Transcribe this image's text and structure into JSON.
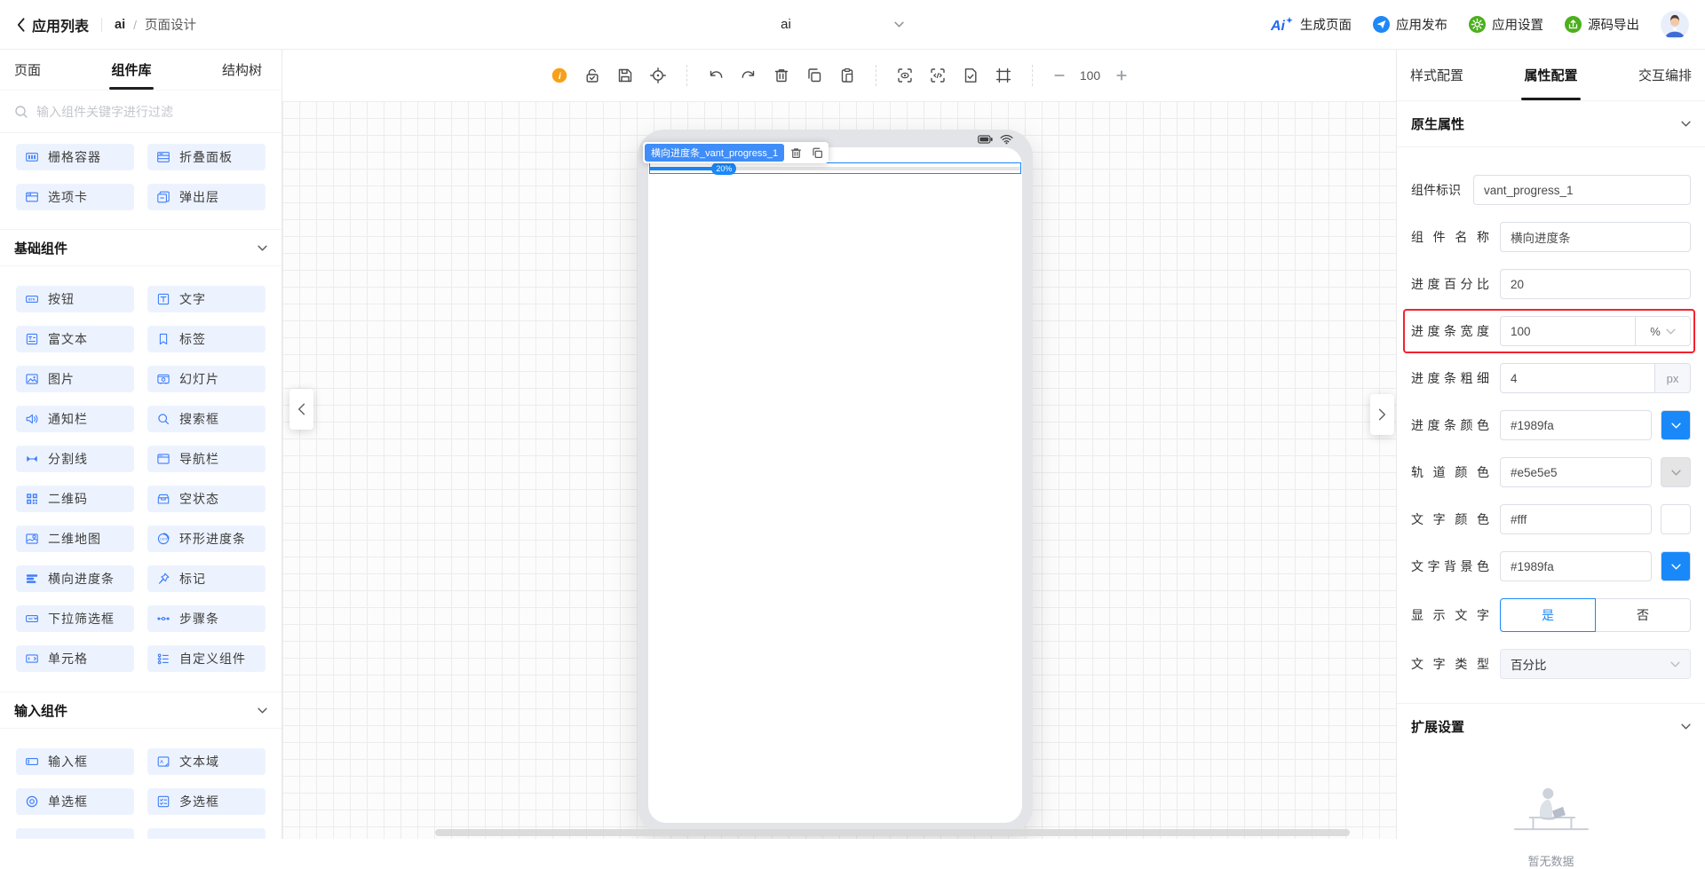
{
  "header": {
    "back_label": "应用列表",
    "breadcrumb": {
      "app": "ai",
      "separator": "/",
      "page": "页面设计"
    },
    "center_title": "ai",
    "actions": [
      {
        "label": "生成页面",
        "icon": "ai-generate-icon"
      },
      {
        "label": "应用发布",
        "icon": "publish-icon"
      },
      {
        "label": "应用设置",
        "icon": "app-settings-icon"
      },
      {
        "label": "源码导出",
        "icon": "code-export-icon"
      }
    ]
  },
  "sidebar": {
    "tabs": [
      {
        "label": "页面",
        "active": false
      },
      {
        "label": "组件库",
        "active": true
      },
      {
        "label": "结构树",
        "active": false
      }
    ],
    "search_placeholder": "输入组件关键字进行过滤",
    "top_items": [
      {
        "label": "栅格容器",
        "icon": "grid-container-icon"
      },
      {
        "label": "折叠面板",
        "icon": "collapse-panel-icon"
      },
      {
        "label": "选项卡",
        "icon": "tabs-component-icon"
      },
      {
        "label": "弹出层",
        "icon": "popup-layer-icon"
      }
    ],
    "sections": [
      {
        "title": "基础组件",
        "partial_row": false,
        "items": [
          {
            "label": "按钮",
            "icon": "button-component-icon"
          },
          {
            "label": "文字",
            "icon": "text-component-icon"
          },
          {
            "label": "富文本",
            "icon": "richtext-icon"
          },
          {
            "label": "标签",
            "icon": "tag-component-icon"
          },
          {
            "label": "图片",
            "icon": "image-component-icon"
          },
          {
            "label": "幻灯片",
            "icon": "slideshow-icon"
          },
          {
            "label": "通知栏",
            "icon": "notice-bar-icon"
          },
          {
            "label": "搜索框",
            "icon": "search-box-icon"
          },
          {
            "label": "分割线",
            "icon": "divider-component-icon"
          },
          {
            "label": "导航栏",
            "icon": "navbar-icon"
          },
          {
            "label": "二维码",
            "icon": "qrcode-icon"
          },
          {
            "label": "空状态",
            "icon": "empty-state-icon"
          },
          {
            "label": "二维地图",
            "icon": "map-icon"
          },
          {
            "label": "环形进度条",
            "icon": "circle-progress-icon"
          },
          {
            "label": "横向进度条",
            "icon": "horizontal-progress-icon"
          },
          {
            "label": "标记",
            "icon": "marker-icon"
          },
          {
            "label": "下拉筛选框",
            "icon": "dropdown-filter-icon"
          },
          {
            "label": "步骤条",
            "icon": "steps-icon"
          },
          {
            "label": "单元格",
            "icon": "cell-icon"
          },
          {
            "label": "自定义组件",
            "icon": "custom-component-icon"
          }
        ]
      },
      {
        "title": "输入组件",
        "partial_row": true,
        "items": [
          {
            "label": "输入框",
            "icon": "input-box-icon"
          },
          {
            "label": "文本域",
            "icon": "textarea-icon"
          },
          {
            "label": "单选框",
            "icon": "radio-icon"
          },
          {
            "label": "多选框",
            "icon": "checkbox-icon"
          }
        ]
      }
    ]
  },
  "canvas_toolbar": {
    "zoom_value": "100",
    "groups": [
      [
        "info-icon",
        "lock-check-icon",
        "save-icon",
        "locate-icon"
      ],
      [
        "undo-icon",
        "redo-icon",
        "trash-icon",
        "copy-icon",
        "paste-icon"
      ],
      [
        "preview-scan-icon",
        "code-scan-icon",
        "doc-check-icon",
        "frame-icon"
      ]
    ]
  },
  "canvas": {
    "selection_tag": "横向进度条_vant_progress_1",
    "progress": {
      "percent": 20,
      "label": "20%"
    },
    "phone_status_icons": [
      "battery-icon",
      "wifi-icon"
    ]
  },
  "inspector": {
    "tabs": [
      {
        "label": "样式配置",
        "active": false
      },
      {
        "label": "属性配置",
        "active": true
      },
      {
        "label": "交互编排",
        "active": false
      }
    ],
    "native_section_title": "原生属性",
    "extension_section_title": "扩展设置",
    "empty_text": "暂无数据",
    "fields": [
      {
        "label": "组件标识",
        "type": "text",
        "value": "vant_progress_1",
        "tight": true
      },
      {
        "label": "组件名称",
        "type": "text",
        "value": "横向进度条"
      },
      {
        "label": "进度百分比",
        "type": "text",
        "value": "20"
      },
      {
        "label": "进度条宽度",
        "type": "unit_select",
        "value": "100",
        "unit": "%",
        "highlight": true
      },
      {
        "label": "进度条粗细",
        "type": "unit_suffix",
        "value": "4",
        "unit": "px"
      },
      {
        "label": "进度条颜色",
        "type": "color",
        "value": "#1989fa",
        "swatch": "#1989fa",
        "chevron": "light"
      },
      {
        "label": "轨道颜色",
        "type": "color",
        "value": "#e5e5e5",
        "swatch": "#e5e5e5",
        "chevron": "dark"
      },
      {
        "label": "文字颜色",
        "type": "color",
        "value": "#fff",
        "swatch": "#ffffff",
        "chevron": "none"
      },
      {
        "label": "文字背景色",
        "type": "color",
        "value": "#1989fa",
        "swatch": "#1989fa",
        "chevron": "light"
      },
      {
        "label": "显示文字",
        "type": "segmented",
        "options": [
          "是",
          "否"
        ],
        "selected": 0
      },
      {
        "label": "文字类型",
        "type": "select",
        "value": "百分比"
      }
    ],
    "colors": {
      "accent": "#1989fa",
      "track": "#e5e5e5",
      "highlight_red": "#f5222d"
    }
  }
}
